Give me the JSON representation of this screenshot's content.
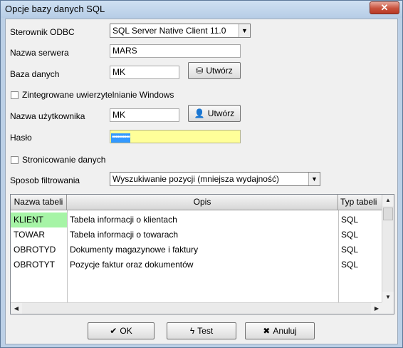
{
  "window": {
    "title": "Opcje bazy danych SQL",
    "close_label": "✕"
  },
  "form": {
    "odbc_label": "Sterownik ODBC",
    "odbc_value": "SQL Server Native Client 11.0",
    "server_label": "Nazwa serwera",
    "server_value": "MARS",
    "db_label": "Baza danych",
    "db_value": "MK",
    "create_db_label": "Utwórz",
    "integrated_auth_label": "Zintegrowane uwierzytelnianie Windows",
    "user_label": "Nazwa użytkownika",
    "user_value": "MK",
    "create_user_label": "Utwórz",
    "password_label": "Hasło",
    "password_value": "••••••••••",
    "paging_label": "Stronicowanie danych",
    "filter_label": "Sposob filtrowania",
    "filter_value": "Wyszukiwanie pozycji (mniejsza wydajność)"
  },
  "table": {
    "columns": [
      "Nazwa tabeli",
      "Opis",
      "Typ tabeli"
    ],
    "rows": [
      [
        "KLIENT",
        "Tabela informacji o klientach",
        "SQL"
      ],
      [
        "TOWAR",
        "Tabela informacji o towarach",
        "SQL"
      ],
      [
        "OBROTYD",
        "Dokumenty magazynowe i faktury",
        "SQL"
      ],
      [
        "OBROTYT",
        "Pozycje faktur oraz dokumentów",
        "SQL"
      ]
    ],
    "selected_color": "#a6f4a6"
  },
  "buttons": {
    "ok": "OK",
    "test": "Test",
    "cancel": "Anuluj"
  }
}
